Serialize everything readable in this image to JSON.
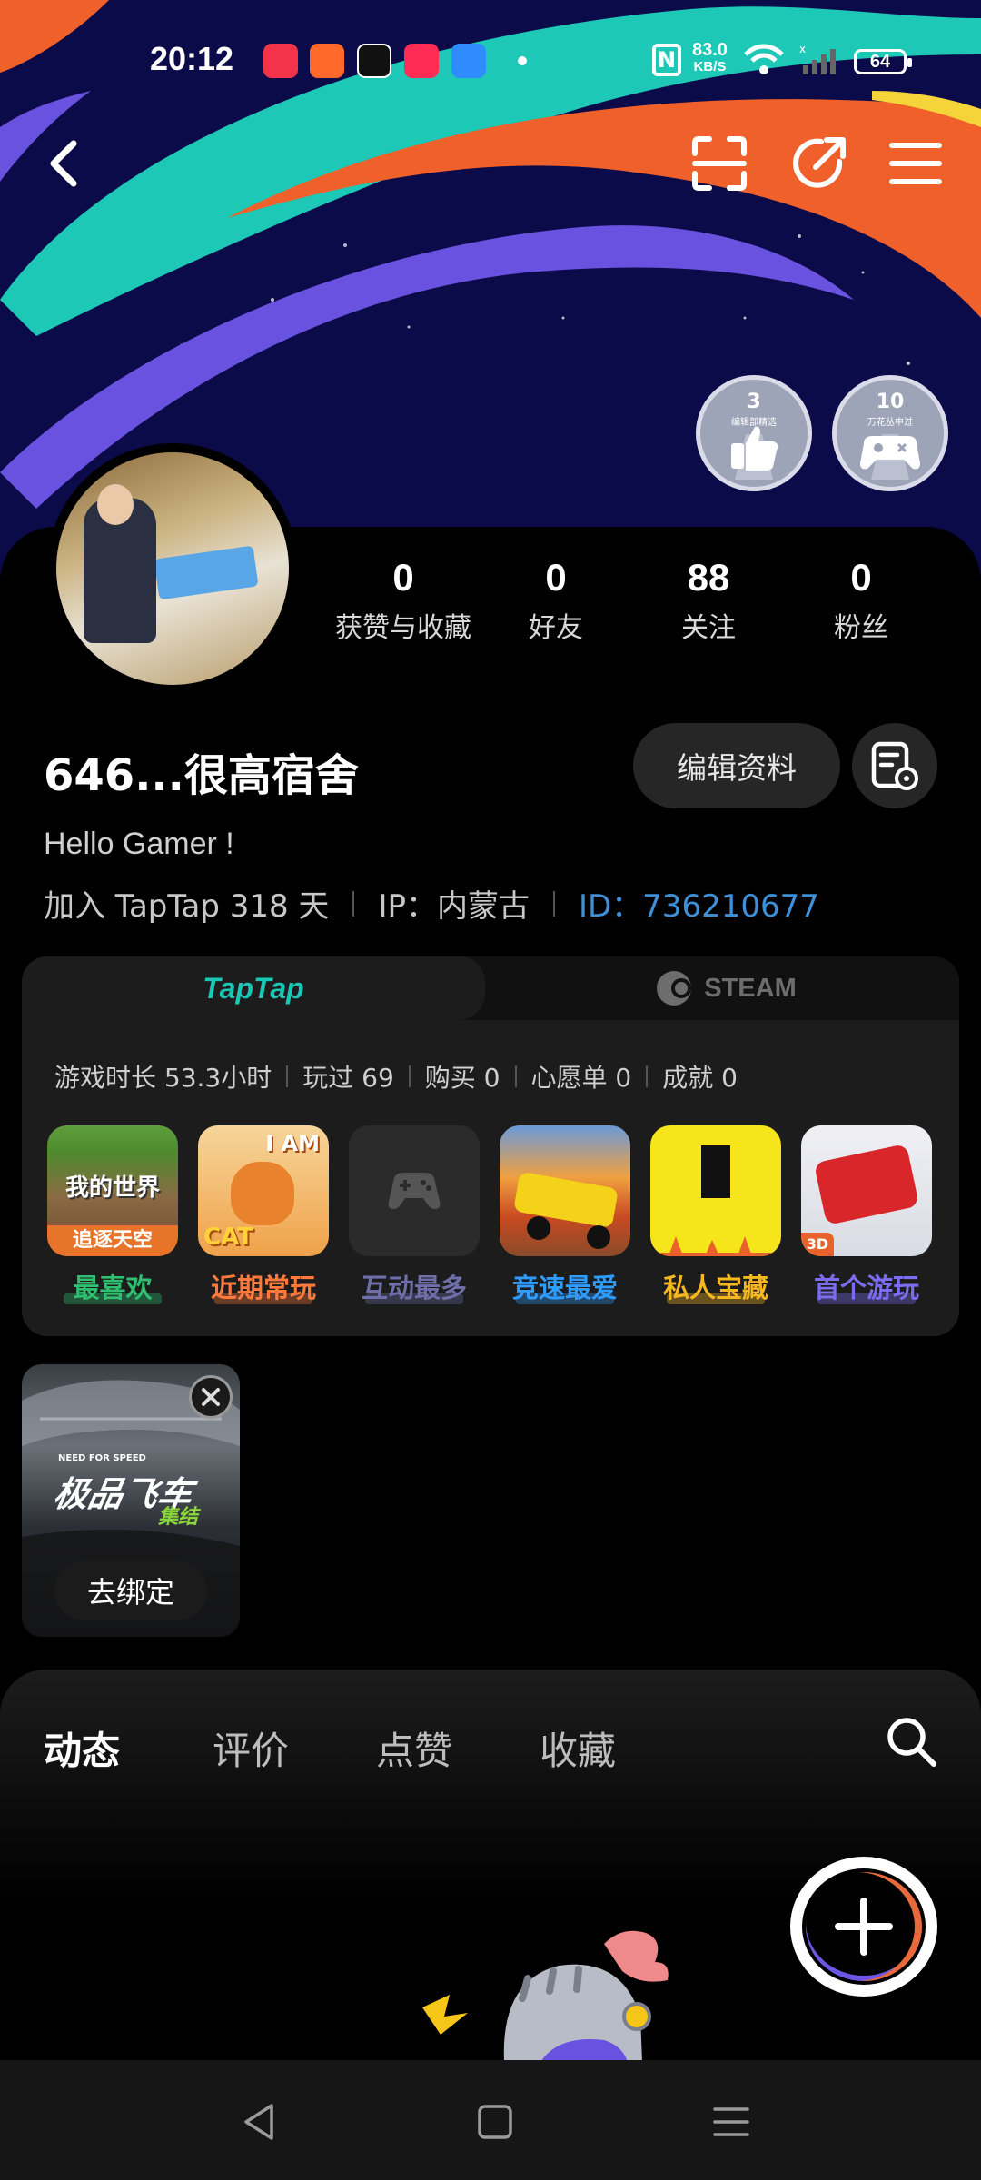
{
  "status_bar": {
    "time": "20:12",
    "nfc": "N",
    "net_speed_value": "83.0",
    "net_speed_unit": "KB/S",
    "battery": "64",
    "icons": [
      "music-app-icon",
      "video-app-icon",
      "clock-app-icon",
      "youtube-app-icon",
      "browser-app-icon",
      "wifi-icon",
      "signal-icon",
      "battery-icon"
    ]
  },
  "header": {
    "actions": [
      "back-icon",
      "scan-icon",
      "share-icon",
      "menu-icon"
    ]
  },
  "badges": [
    {
      "num": "3",
      "caption": "编辑部精选",
      "icon": "thumbs-up-icon"
    },
    {
      "num": "10",
      "caption": "万花丛中过",
      "icon": "gamepad-icon"
    }
  ],
  "profile": {
    "stats": [
      {
        "value": "0",
        "label": "获赞与收藏"
      },
      {
        "value": "0",
        "label": "好友"
      },
      {
        "value": "88",
        "label": "关注"
      },
      {
        "value": "0",
        "label": "粉丝"
      }
    ],
    "username": "646...很高宿舍",
    "edit_label": "编辑资料",
    "bio": "Hello Gamer !",
    "joined": "加入 TapTap 318 天",
    "ip": "IP：内蒙古",
    "id": "ID：736210677"
  },
  "game_card": {
    "tab_taptap": "TapTap",
    "tab_steam": "STEAM",
    "stats": [
      "游戏时长 53.3小时",
      "玩过 69",
      "购买 0",
      "心愿单 0",
      "成就 0"
    ],
    "games": [
      {
        "label": "最喜欢",
        "icon_text": "我的世界",
        "icon_sub": "追逐天空",
        "color": "#2fbf71"
      },
      {
        "label": "近期常玩",
        "icon_text": "I AM",
        "icon_sub": "CAT",
        "color": "#ff7a3c"
      },
      {
        "label": "互动最多",
        "icon_text": "",
        "icon_sub": "",
        "color": "#6e6eaa"
      },
      {
        "label": "竞速最爱",
        "icon_text": "",
        "icon_sub": "",
        "color": "#2f9cff"
      },
      {
        "label": "私人宝藏",
        "icon_text": "",
        "icon_sub": "",
        "color": "#f6b820"
      },
      {
        "label": "首个游玩",
        "icon_text": "3D",
        "icon_sub": "",
        "color": "#7b6cf0"
      }
    ]
  },
  "bound_game": {
    "title": "极品飞车",
    "subtitle": "NEED FOR SPEED",
    "tag": "集结",
    "unbind_label": "去绑定"
  },
  "feed_tabs": [
    {
      "label": "动态",
      "active": true
    },
    {
      "label": "评价",
      "active": false
    },
    {
      "label": "点赞",
      "active": false
    },
    {
      "label": "收藏",
      "active": false
    }
  ],
  "colors": {
    "accent": "#16b8a8",
    "id_link": "#3d8fd8",
    "banner_bg": "#0c0b4a",
    "banner_teal": "#1ec8b6",
    "banner_orange": "#f0602a",
    "banner_purple": "#6a52e0"
  }
}
